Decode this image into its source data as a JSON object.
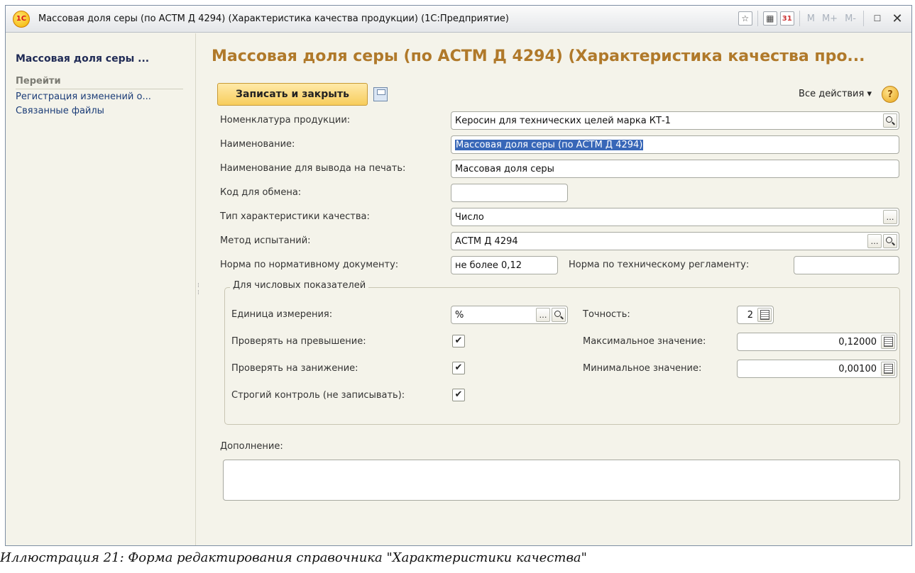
{
  "window": {
    "logo_text": "1С",
    "title": "Массовая доля серы (по АСТМ Д 4294) (Характеристика качества продукции)  (1С:Предприятие)",
    "tools": {
      "m": "M",
      "mplus": "M+",
      "mminus": "M-"
    }
  },
  "sidebar": {
    "title": "Массовая доля серы ...",
    "goto": "Перейти",
    "links": [
      "Регистрация изменений о...",
      "Связанные файлы"
    ]
  },
  "form": {
    "title": "Массовая доля серы (по АСТМ Д 4294) (Характеристика качества про...",
    "save_close": "Записать и закрыть",
    "all_actions": "Все действия ▾",
    "help": "?",
    "fields": {
      "nomenclature": {
        "label": "Номенклатура продукции:",
        "value": "Керосин для технических целей марка КТ-1"
      },
      "name": {
        "label": "Наименование:",
        "value": "Массовая доля серы (по АСТМ Д 4294)"
      },
      "print_name": {
        "label": "Наименование для вывода на печать:",
        "value": "Массовая доля серы"
      },
      "exchange_code": {
        "label": "Код для обмена:",
        "value": ""
      },
      "quality_type": {
        "label": "Тип характеристики качества:",
        "value": "Число"
      },
      "test_method": {
        "label": "Метод испытаний:",
        "value": "АСТМ Д 4294"
      },
      "norm_doc": {
        "label": "Норма по нормативному документу:",
        "value": "не более 0,12"
      },
      "norm_tech": {
        "label": "Норма по техническому регламенту:",
        "value": ""
      }
    },
    "numeric_group": {
      "title": "Для числовых показателей",
      "unit": {
        "label": "Единица измерения:",
        "value": "%"
      },
      "precision": {
        "label": "Точность:",
        "value": "2"
      },
      "check_over": {
        "label": "Проверять на превышение:",
        "checked": "✔"
      },
      "check_under": {
        "label": "Проверять на занижение:",
        "checked": "✔"
      },
      "strict": {
        "label": "Строгий контроль (не записывать):",
        "checked": "✔"
      },
      "max": {
        "label": "Максимальное значение:",
        "value": "0,12000"
      },
      "min": {
        "label": "Минимальное значение:",
        "value": "0,00100"
      }
    },
    "addition": {
      "label": "Дополнение:",
      "value": ""
    }
  },
  "caption": "Иллюстрация 21: Форма редактирования справочника \"Характеристики качества\""
}
